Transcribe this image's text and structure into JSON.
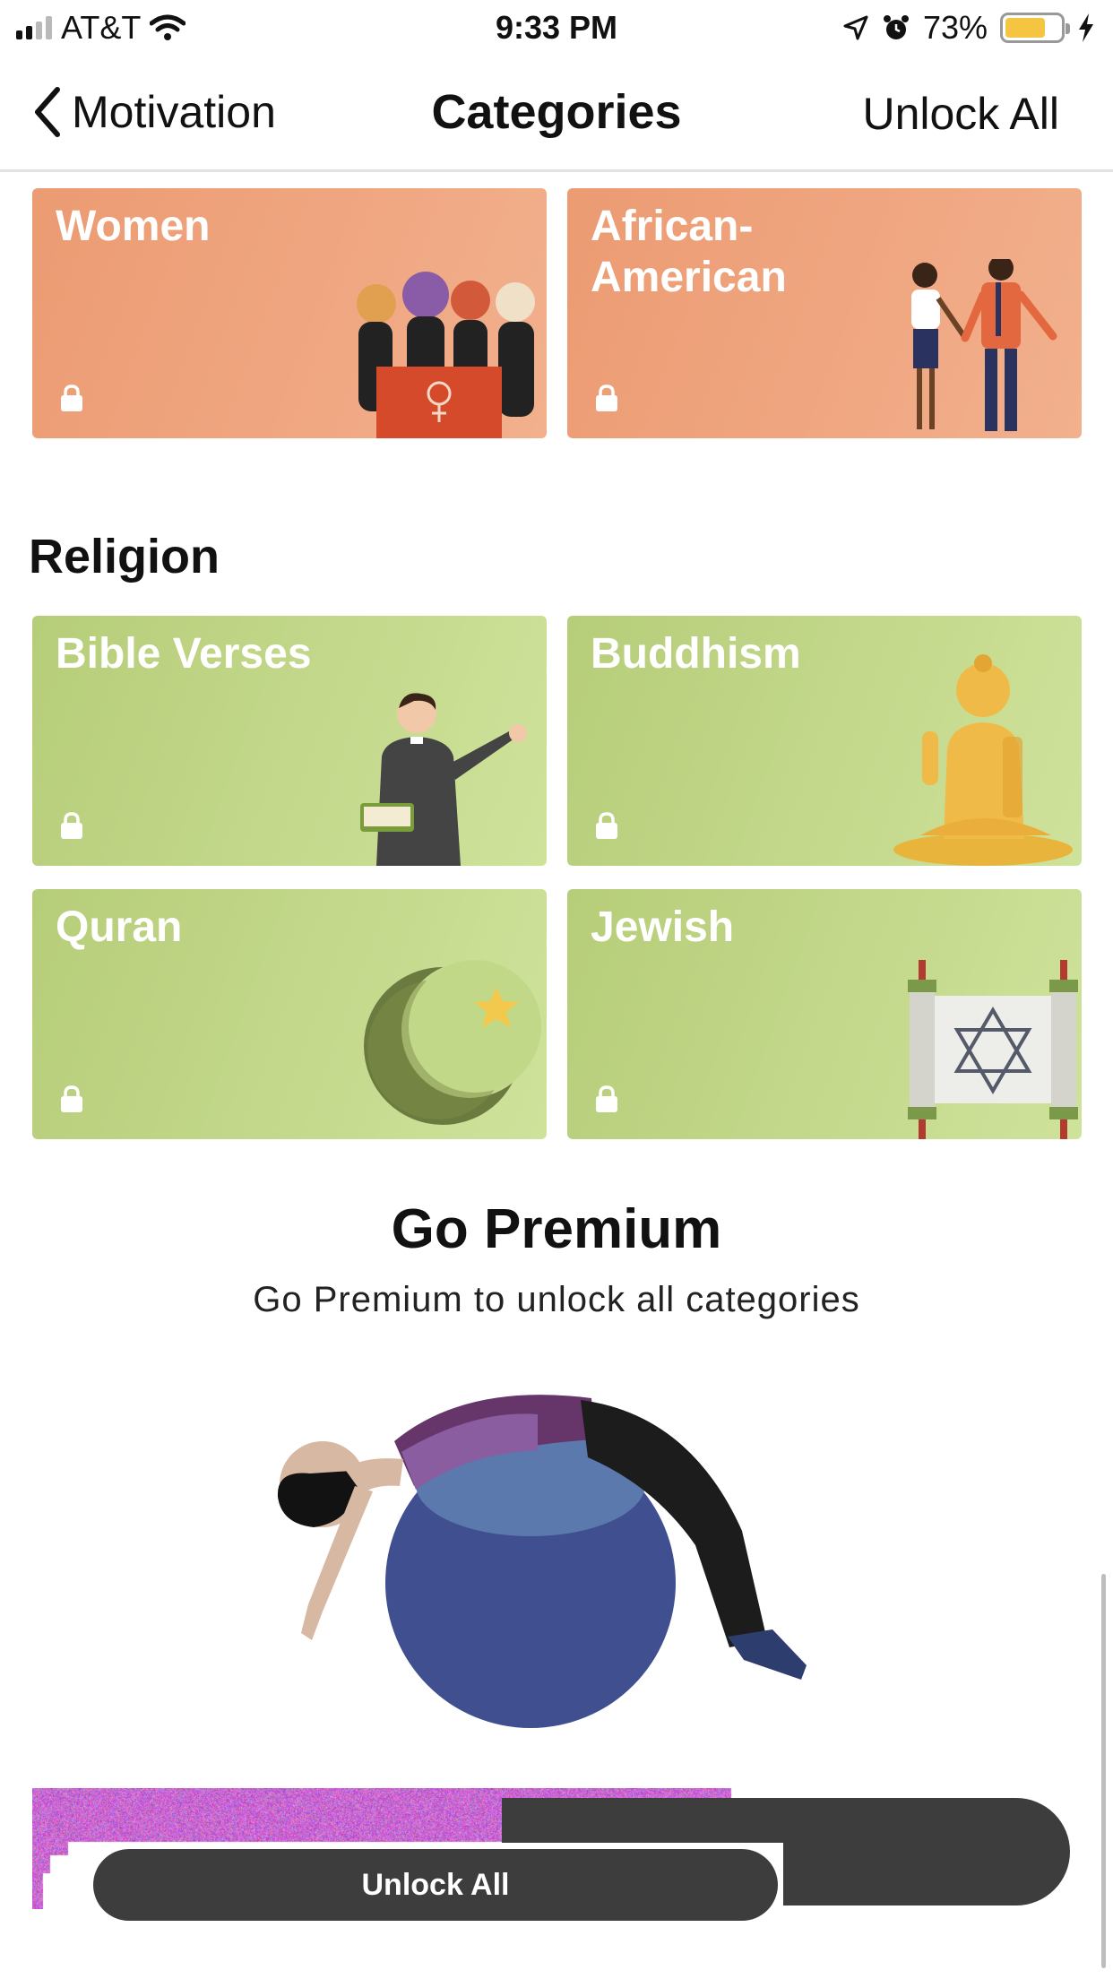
{
  "status_bar": {
    "carrier": "AT&T",
    "time": "9:33 PM",
    "battery_percent": "73%",
    "battery_level": 0.73,
    "icons": [
      "signal-icon",
      "wifi-icon",
      "location-icon",
      "alarm-icon",
      "battery-icon",
      "charging-icon"
    ]
  },
  "nav": {
    "back_label": "Motivation",
    "title": "Categories",
    "action_label": "Unlock All"
  },
  "categories_top": [
    {
      "title": "Women",
      "locked": true,
      "color": "orange",
      "art": "women-group-illustration"
    },
    {
      "title": "African-American",
      "locked": true,
      "color": "orange",
      "art": "couple-holding-hands-illustration"
    }
  ],
  "religion": {
    "title": "Religion",
    "cards": [
      {
        "title": "Bible Verses",
        "locked": true,
        "color": "green",
        "art": "priest-with-bible-illustration"
      },
      {
        "title": "Buddhism",
        "locked": true,
        "color": "green",
        "art": "buddha-statue-illustration"
      },
      {
        "title": "Quran",
        "locked": true,
        "color": "green",
        "art": "crescent-star-illustration"
      },
      {
        "title": "Jewish",
        "locked": true,
        "color": "green",
        "art": "star-of-david-scroll-illustration"
      }
    ]
  },
  "premium": {
    "title": "Go Premium",
    "subtitle": "Go Premium to unlock all categories",
    "button_label": "Unlock All"
  },
  "colors": {
    "orange_card": "#ec9b72",
    "green_card": "#b6cd79",
    "button": "#3d3d3d",
    "battery": "#f5c542"
  }
}
